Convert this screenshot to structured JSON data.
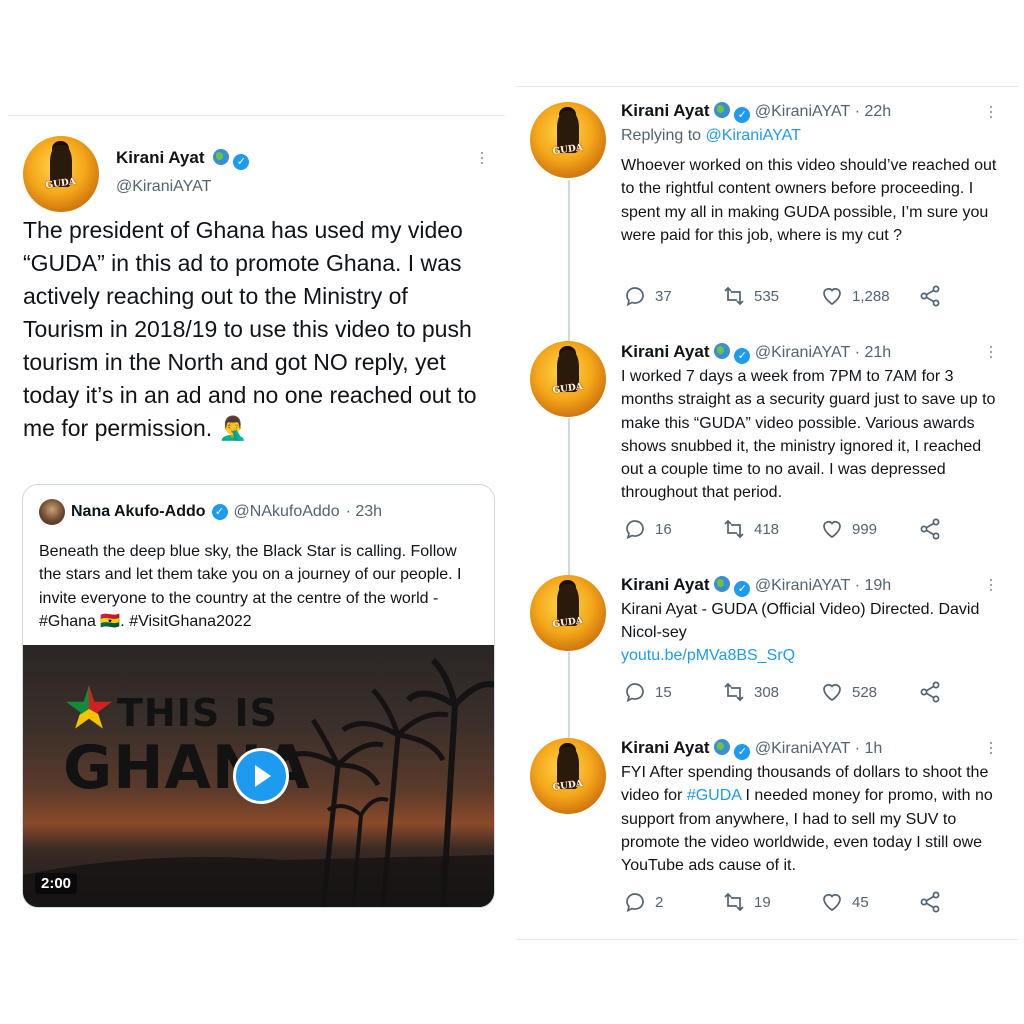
{
  "main_tweet": {
    "name": "Kirani Ayat",
    "handle": "@KiraniAYAT",
    "text": "The president of Ghana has used my video “GUDA” in this ad to promote Ghana. I was actively reaching out to the Ministry of Tourism in 2018/19 to use this video to push tourism in the North and got NO reply, yet today it’s in an ad and no one reached out to me for permission. 🤦‍♂️",
    "quoted": {
      "name": "Nana Akufo-Addo",
      "handle": "@NAkufoAddo",
      "time": "· 23h",
      "text": "Beneath the deep blue sky, the Black Star is calling. Follow the stars and let them take you on a journey of our people. I invite everyone to the country at the centre of the world - #Ghana 🇬🇭. #VisitGhana2022",
      "video_title_1": "THIS IS",
      "video_title_2": "GHANA",
      "duration": "2:00"
    }
  },
  "replies": [
    {
      "name": "Kirani Ayat",
      "handle": "@KiraniAYAT",
      "time": "· 22h",
      "replying_prefix": "Replying to ",
      "replying_to": "@KiraniAYAT",
      "text": "Whoever worked on this video should’ve reached out to the rightful content owners before proceeding. I spent my all in making GUDA possible, I’m sure you were paid for this job, where is my cut ?",
      "replies": "37",
      "retweets": "535",
      "likes": "1,288"
    },
    {
      "name": "Kirani Ayat",
      "handle": "@KiraniAYAT",
      "time": "· 21h",
      "text": "I worked 7 days a week from 7PM to 7AM for 3 months straight as a security guard just to save up to make this “GUDA” video possible. Various awards shows snubbed it, the ministry ignored it, I reached out a couple time to no avail. I was depressed throughout that period.",
      "replies": "16",
      "retweets": "418",
      "likes": "999"
    },
    {
      "name": "Kirani Ayat",
      "handle": "@KiraniAYAT",
      "time": "· 19h",
      "text": "Kirani Ayat - GUDA (Official Video) Directed. David Nicol-sey",
      "link": "youtu.be/pMVa8BS_SrQ",
      "replies": "15",
      "retweets": "308",
      "likes": "528"
    },
    {
      "name": "Kirani Ayat",
      "handle": "@KiraniAYAT",
      "time": "· 1h",
      "text_before": "FYI After spending thousands of dollars to shoot the video for ",
      "hashtag": "#GUDA",
      "text_after": " I needed money for promo, with no support from anywhere, I had to sell my SUV to promote the video worldwide, even today I still owe YouTube ads cause of it.",
      "replies": "2",
      "retweets": "19",
      "likes": "45"
    }
  ],
  "avatar_text": "GUDA"
}
